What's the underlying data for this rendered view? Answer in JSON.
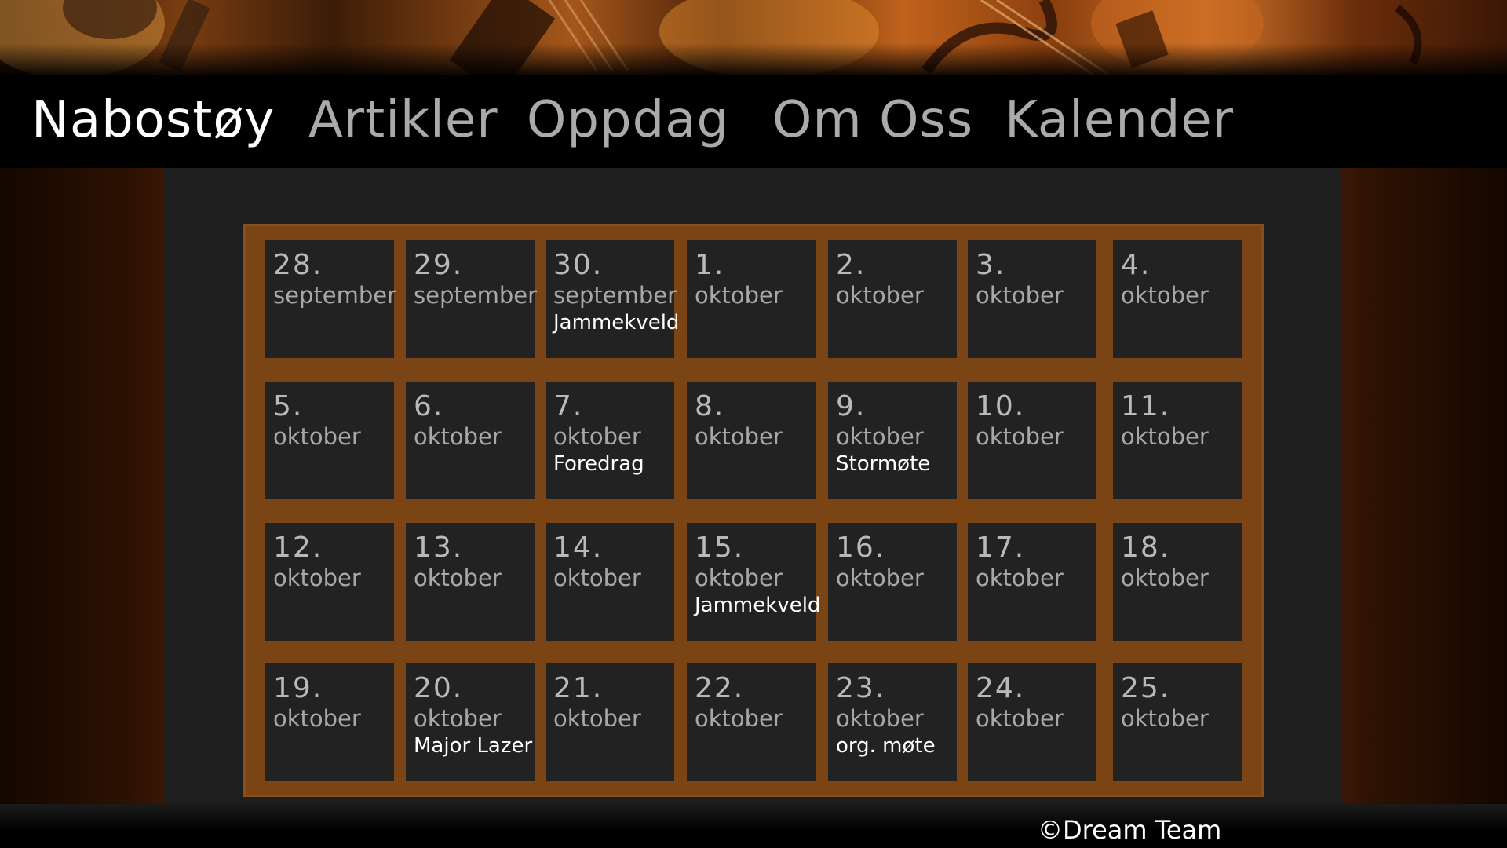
{
  "nav": {
    "brand": "Nabostøy",
    "items": [
      {
        "label": "Artikler"
      },
      {
        "label": "Oppdag"
      },
      {
        "label": "Om Oss"
      },
      {
        "label": "Kalender"
      }
    ]
  },
  "calendar": {
    "days": [
      {
        "num": "28.",
        "month": "september",
        "event": ""
      },
      {
        "num": "29.",
        "month": "september",
        "event": ""
      },
      {
        "num": "30.",
        "month": "september",
        "event": "Jammekveld"
      },
      {
        "num": "1.",
        "month": "oktober",
        "event": ""
      },
      {
        "num": "2.",
        "month": "oktober",
        "event": ""
      },
      {
        "num": "3.",
        "month": "oktober",
        "event": ""
      },
      {
        "num": "4.",
        "month": "oktober",
        "event": ""
      },
      {
        "num": "5.",
        "month": "oktober",
        "event": ""
      },
      {
        "num": "6.",
        "month": "oktober",
        "event": ""
      },
      {
        "num": "7.",
        "month": "oktober",
        "event": "Foredrag"
      },
      {
        "num": "8.",
        "month": "oktober",
        "event": ""
      },
      {
        "num": "9.",
        "month": "oktober",
        "event": "Stormøte"
      },
      {
        "num": "10.",
        "month": "oktober",
        "event": ""
      },
      {
        "num": "11.",
        "month": "oktober",
        "event": ""
      },
      {
        "num": "12.",
        "month": "oktober",
        "event": ""
      },
      {
        "num": "13.",
        "month": "oktober",
        "event": ""
      },
      {
        "num": "14.",
        "month": "oktober",
        "event": ""
      },
      {
        "num": "15.",
        "month": "oktober",
        "event": "Jammekveld"
      },
      {
        "num": "16.",
        "month": "oktober",
        "event": ""
      },
      {
        "num": "17.",
        "month": "oktober",
        "event": ""
      },
      {
        "num": "18.",
        "month": "oktober",
        "event": ""
      },
      {
        "num": "19.",
        "month": "oktober",
        "event": ""
      },
      {
        "num": "20.",
        "month": "oktober",
        "event": "Major Lazer"
      },
      {
        "num": "21.",
        "month": "oktober",
        "event": ""
      },
      {
        "num": "22.",
        "month": "oktober",
        "event": ""
      },
      {
        "num": "23.",
        "month": "oktober",
        "event": "org. møte"
      },
      {
        "num": "24.",
        "month": "oktober",
        "event": ""
      },
      {
        "num": "25.",
        "month": "oktober",
        "event": ""
      }
    ]
  },
  "footer": {
    "text": "©Dream Team"
  }
}
